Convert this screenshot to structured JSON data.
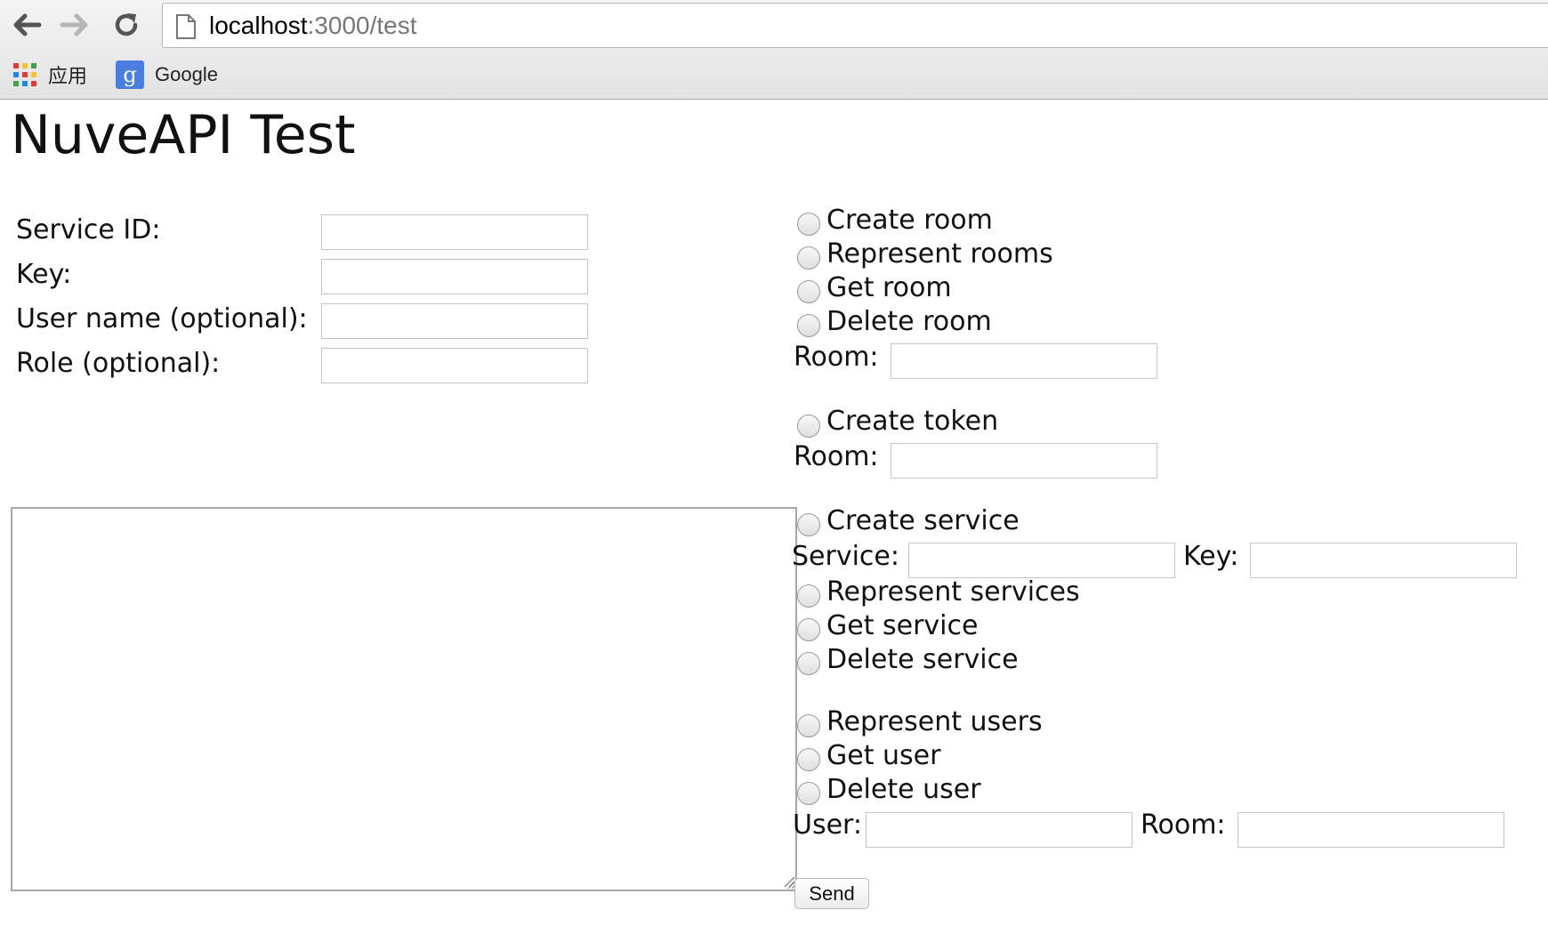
{
  "browser": {
    "url_host": "localhost",
    "url_path": ":3000/test",
    "bookmarks": [
      {
        "label": "应用",
        "icon": "apps-grid-icon"
      },
      {
        "label": "Google",
        "icon": "google-g-icon"
      }
    ]
  },
  "page": {
    "title": "NuveAPI Test",
    "credentials": {
      "service_id_label": "Service ID:",
      "key_label": "Key:",
      "user_name_label": "User name (optional):",
      "role_label": "Role (optional):"
    },
    "room_ops": {
      "create_room": "Create room",
      "represent_rooms": "Represent rooms",
      "get_room": "Get room",
      "delete_room": "Delete room",
      "room_label": "Room:"
    },
    "token_ops": {
      "create_token": "Create token",
      "room_label": "Room:"
    },
    "service_ops": {
      "create_service": "Create service",
      "service_label": "Service:",
      "key_label": "Key:",
      "represent_services": "Represent services",
      "get_service": "Get service",
      "delete_service": "Delete service"
    },
    "user_ops": {
      "represent_users": "Represent users",
      "get_user": "Get user",
      "delete_user": "Delete user",
      "user_label": "User:",
      "room_label": "Room:"
    },
    "send_label": "Send"
  }
}
